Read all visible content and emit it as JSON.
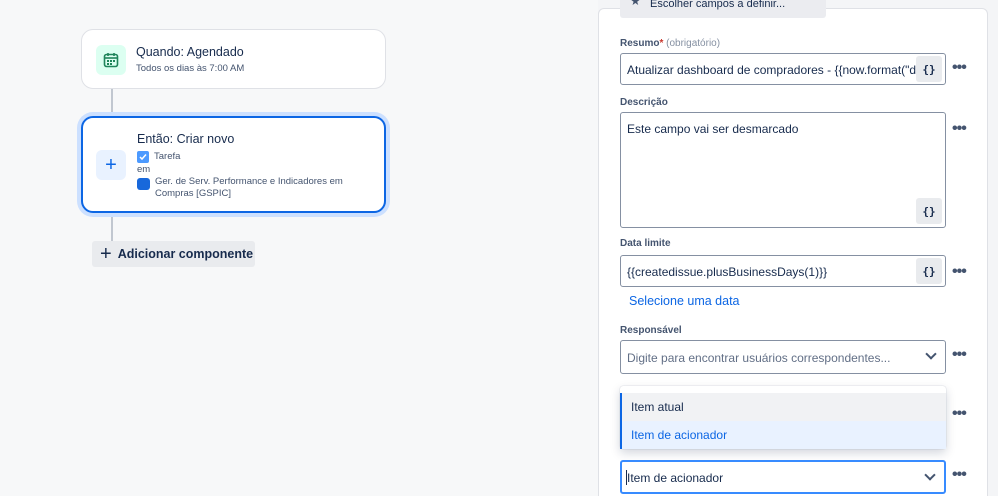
{
  "canvas": {
    "trigger": {
      "title": "Quando: Agendado",
      "subtitle": "Todos os dias às 7:00 AM",
      "icon": "calendar-icon"
    },
    "action": {
      "title": "Então: Criar novo",
      "issue_type": "Tarefa",
      "in_label": "em",
      "project": "Ger. de Serv. Performance e Indicadores em Compras [GSPIC]",
      "icon": "plus-icon"
    },
    "add_component_label": "Adicionar componente"
  },
  "panel": {
    "top_button_label": "Escolher campos a definir...",
    "fields": {
      "summary": {
        "label": "Resumo",
        "required_marker": "*",
        "hint": "(obrigatório)",
        "value": "Atualizar dashboard de compradores - {{now.format(\"d"
      },
      "description": {
        "label": "Descrição",
        "value": "Este campo vai ser desmarcado"
      },
      "due_date": {
        "label": "Data limite",
        "value": "{{createdissue.plusBusinessDays(1)}}",
        "link": "Selecione uma data"
      },
      "assignee": {
        "label": "Responsável",
        "placeholder": "Digite para encontrar usuários correspondentes..."
      },
      "reporter": {
        "value": "Item de acionador"
      }
    },
    "dropdown_options": [
      "Item atual",
      "Item de acionador"
    ],
    "smart_value_glyph": "{}",
    "more_glyph": "•••"
  },
  "colors": {
    "accent": "#0c66e4",
    "focus_ring": "#cce0ff",
    "required": "#c9372c",
    "trigger_icon_bg": "#dcfff1"
  }
}
